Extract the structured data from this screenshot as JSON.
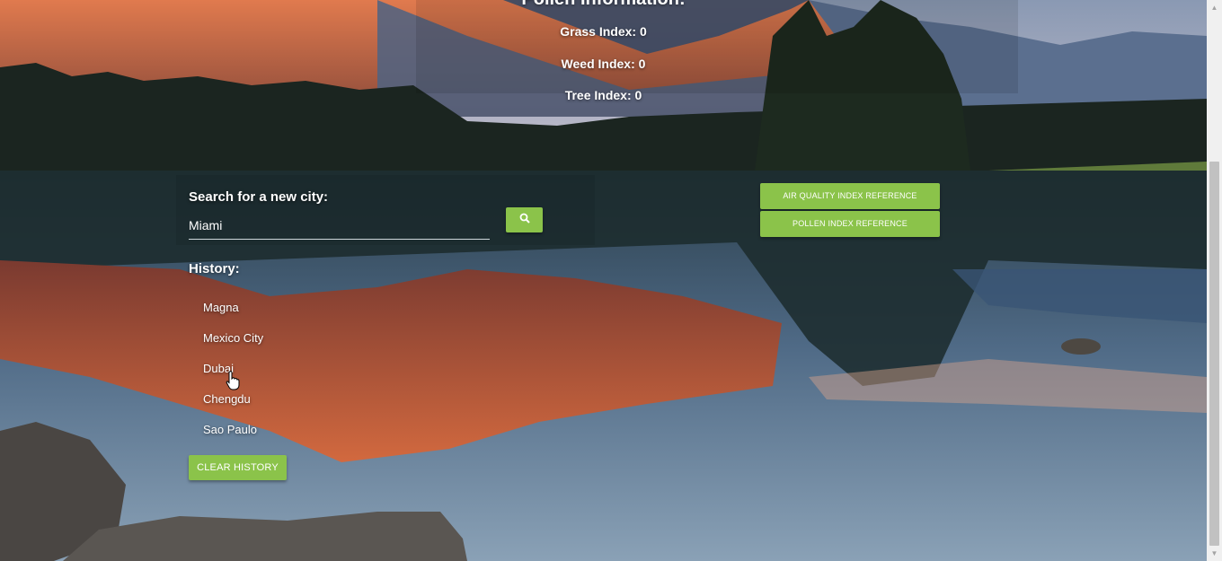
{
  "pollen": {
    "title": "Pollen Information:",
    "grass": "Grass Index: 0",
    "weed": "Weed Index: 0",
    "tree": "Tree Index: 0"
  },
  "search": {
    "label": "Search for a new city:",
    "value": "Miami",
    "button_icon": "search-icon"
  },
  "history": {
    "label": "History:",
    "items": [
      "Magna",
      "Mexico City",
      "Dubai",
      "Chengdu",
      "Sao Paulo"
    ],
    "clear_label": "CLEAR HISTORY"
  },
  "references": {
    "aqi_label": "AIR QUALITY INDEX REFERENCE",
    "pollen_label": "POLLEN INDEX REFERENCE"
  },
  "colors": {
    "accent": "#8bc34a"
  }
}
